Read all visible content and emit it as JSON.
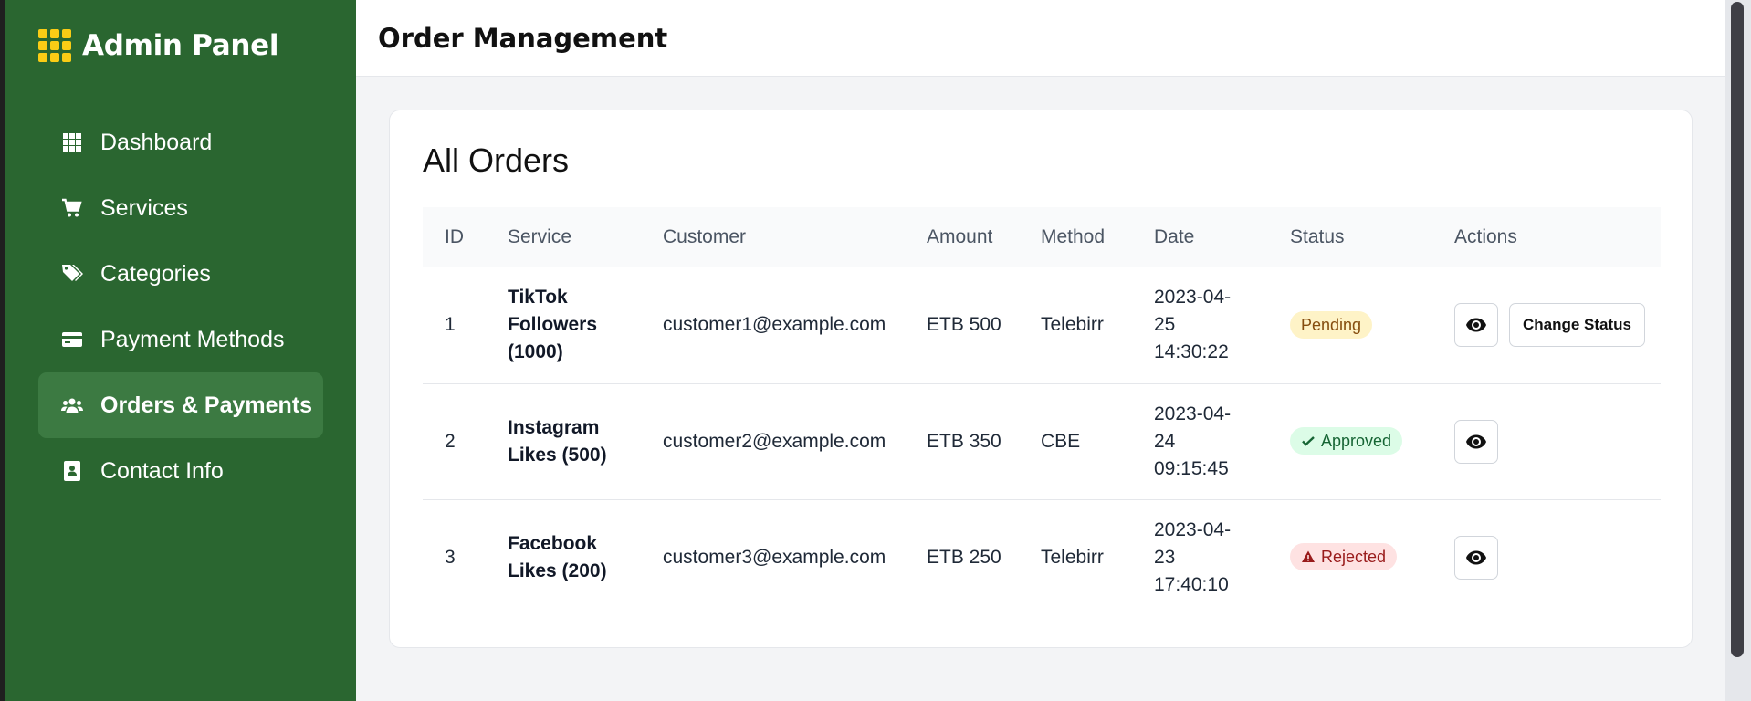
{
  "brand": {
    "title": "Admin Panel",
    "icon": "grid-icon",
    "icon_color": "#facc15"
  },
  "sidebar": {
    "background": "#2a6630",
    "items": [
      {
        "label": "Dashboard",
        "icon": "dashboard-grid-icon",
        "active": false
      },
      {
        "label": "Services",
        "icon": "cart-icon",
        "active": false
      },
      {
        "label": "Categories",
        "icon": "tags-icon",
        "active": false
      },
      {
        "label": "Payment Methods",
        "icon": "credit-card-icon",
        "active": false
      },
      {
        "label": "Orders & Payments",
        "icon": "users-icon",
        "active": true
      },
      {
        "label": "Contact Info",
        "icon": "address-book-icon",
        "active": false
      }
    ]
  },
  "header": {
    "title": "Order Management"
  },
  "orders": {
    "title": "All Orders",
    "columns": [
      "ID",
      "Service",
      "Customer",
      "Amount",
      "Method",
      "Date",
      "Status",
      "Actions"
    ],
    "rows": [
      {
        "id": "1",
        "service_line1": "TikTok",
        "service_line2": "Followers",
        "service_line3": "(1000)",
        "customer": "customer1@example.com",
        "amount": "ETB 500",
        "method": "Telebirr",
        "date_line1": "2023-04-",
        "date_line2": "25",
        "date_line3": "14:30:22",
        "status": "Pending",
        "status_color": "#fef3c7",
        "change_status_label": "Change Status"
      },
      {
        "id": "2",
        "service_line1": "Instagram",
        "service_line2": "Likes (500)",
        "customer": "customer2@example.com",
        "amount": "ETB 350",
        "method": "CBE",
        "date_line1": "2023-04-",
        "date_line2": "24",
        "date_line3": "09:15:45",
        "status": "Approved",
        "status_color": "#dcfce7"
      },
      {
        "id": "3",
        "service_line1": "Facebook",
        "service_line2": "Likes (200)",
        "customer": "customer3@example.com",
        "amount": "ETB 250",
        "method": "Telebirr",
        "date_line1": "2023-04-",
        "date_line2": "23",
        "date_line3": "17:40:10",
        "status": "Rejected",
        "status_color": "#fee2e2"
      }
    ]
  }
}
